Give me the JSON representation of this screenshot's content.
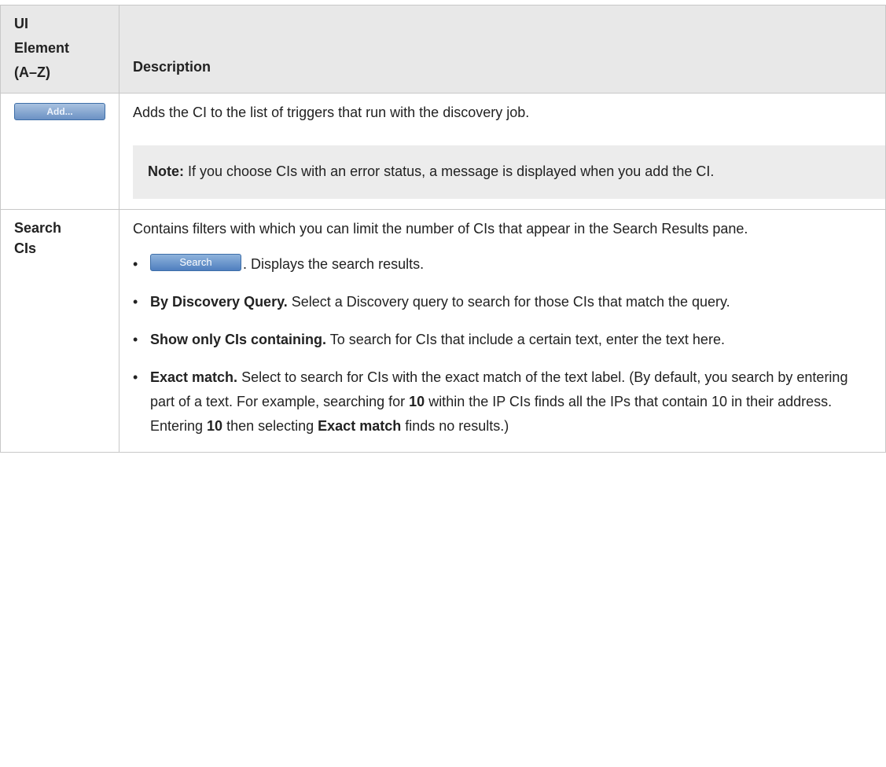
{
  "header": {
    "col1_lines": [
      "UI",
      "Element",
      "(A–Z)"
    ],
    "col2": "Description"
  },
  "rows": {
    "add": {
      "button_label": "Add...",
      "description": "Adds the CI to the list of triggers that run with the discovery job.",
      "note_label": "Note:",
      "note_text": " If you choose CIs with an error status, a message is displayed when you add the CI."
    },
    "search": {
      "element_line1": "Search",
      "element_line2": "CIs",
      "description": "Contains filters with which you can limit the number of CIs that appear in the Search Results pane.",
      "search_button_label": "Search",
      "search_button_text": ". Displays the search results.",
      "by_query_label": "By Discovery Query.",
      "by_query_text": " Select a Discovery query to search for those CIs that match the query.",
      "show_only_label": "Show only CIs containing.",
      "show_only_text": " To search for CIs that include a certain text, enter the text here.",
      "exact_label": "Exact match.",
      "exact_text_1": " Select to search for CIs with the exact match of the text label. (By default, you search by entering part of a text. For example, searching for ",
      "exact_bold_1": "10",
      "exact_text_2": " within the IP CIs finds all the IPs that contain 10 in their address. Entering ",
      "exact_bold_2": "10",
      "exact_text_3": " then selecting ",
      "exact_bold_3": "Exact match",
      "exact_text_4": " finds no results.)"
    }
  }
}
